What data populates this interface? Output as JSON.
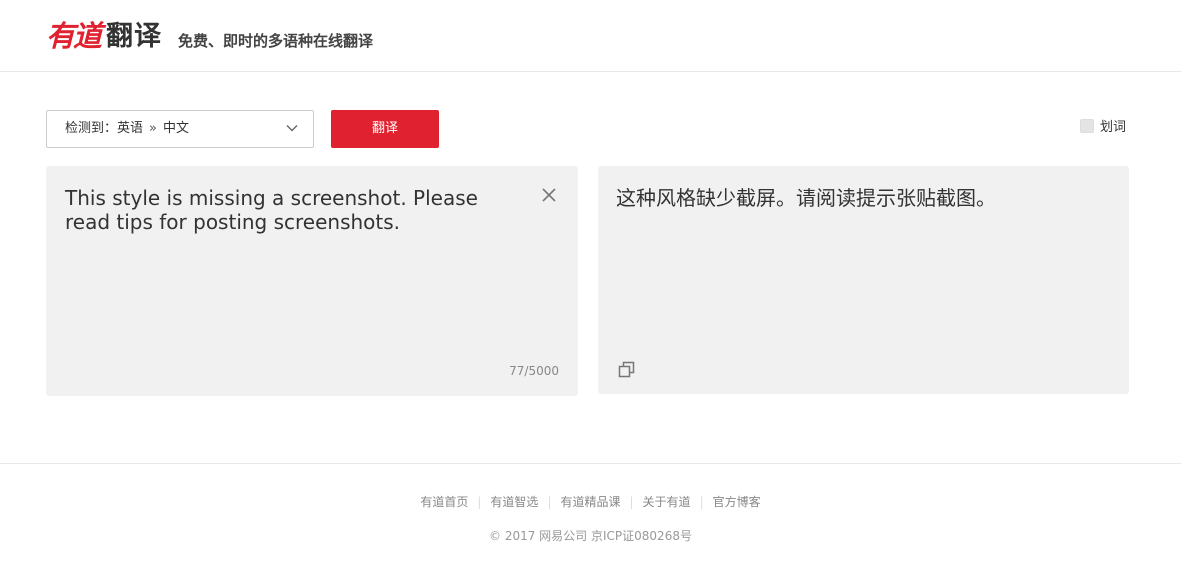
{
  "header": {
    "logo_brand": "有道",
    "logo_product": "翻译",
    "tagline": "免费、即时的多语种在线翻译"
  },
  "toolbar": {
    "lang_select_value": "检测到：英语",
    "lang_sep": "»",
    "lang_target": "中文",
    "translate_label": "翻译",
    "word_pick_label": "划词"
  },
  "source": {
    "text": "This style is missing a screenshot. Please read tips for posting screenshots.",
    "char_count": "77/5000"
  },
  "target": {
    "text": "这种风格缺少截屏。请阅读提示张贴截图。"
  },
  "footer": {
    "links": [
      "有道首页",
      "有道智选",
      "有道精品课",
      "关于有道",
      "官方博客"
    ],
    "copyright": "© 2017 网易公司 京ICP证080268号"
  },
  "colors": {
    "brand_red": "#e0212f",
    "panel_bg": "#f1f1f1"
  }
}
